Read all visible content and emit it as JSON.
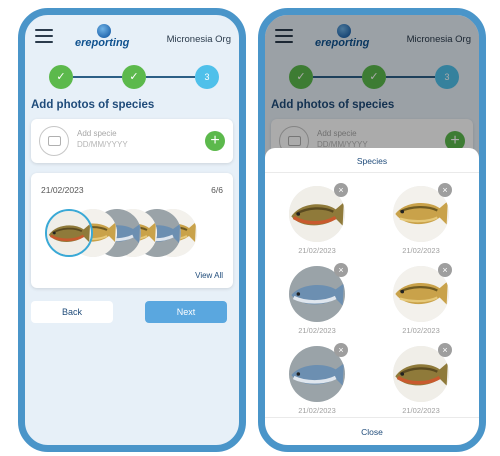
{
  "app": {
    "logo_text": "ereporting",
    "org_name": "Micronesia Org"
  },
  "stepper": {
    "steps": [
      "✓",
      "✓",
      "3"
    ],
    "current_step": 3
  },
  "page": {
    "title": "Add photos of species"
  },
  "add_species": {
    "label": "Add specie",
    "date_placeholder": "DD/MM/YYYY",
    "plus_label": "+"
  },
  "photos_card": {
    "date": "21/02/2023",
    "count": "6/6",
    "view_all": "View All"
  },
  "nav": {
    "back": "Back",
    "next": "Next"
  },
  "modal": {
    "title": "Species",
    "close": "Close",
    "remove_icon": "×",
    "items": [
      {
        "date": "21/02/2023",
        "fish": "brown-trout"
      },
      {
        "date": "21/02/2023",
        "fish": "golden-trout"
      },
      {
        "date": "21/02/2023",
        "fish": "blue-fish"
      },
      {
        "date": "21/02/2023",
        "fish": "golden-trout"
      },
      {
        "date": "21/02/2023",
        "fish": "blue-fish"
      },
      {
        "date": "21/02/2023",
        "fish": "brown-trout"
      }
    ]
  },
  "colors": {
    "accent": "#4a95c9",
    "done": "#5cb94c",
    "current": "#4fc0ea",
    "title": "#1f4b7a"
  }
}
